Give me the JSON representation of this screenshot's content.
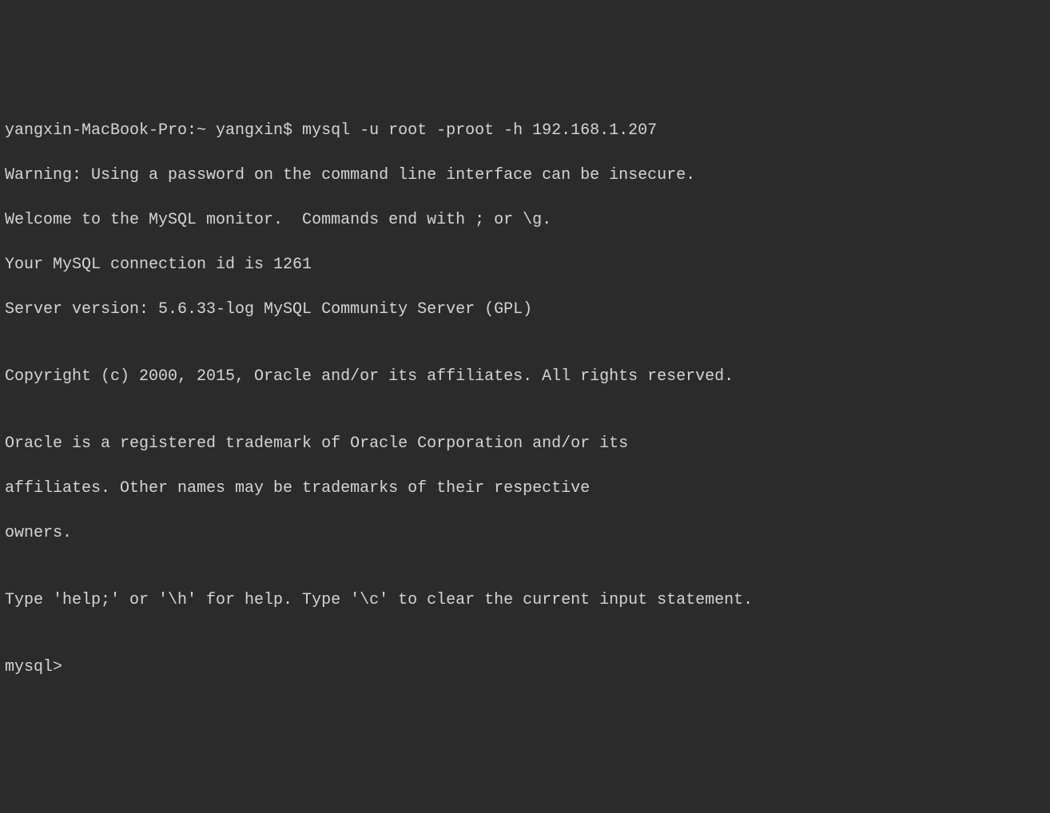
{
  "terminal": {
    "prompt_line": "yangxin-MacBook-Pro:~ yangxin$ mysql -u root -proot -h 192.168.1.207",
    "lines": [
      "Warning: Using a password on the command line interface can be insecure.",
      "Welcome to the MySQL monitor.  Commands end with ; or \\g.",
      "Your MySQL connection id is 1261",
      "Server version: 5.6.33-log MySQL Community Server (GPL)",
      "",
      "Copyright (c) 2000, 2015, Oracle and/or its affiliates. All rights reserved.",
      "",
      "Oracle is a registered trademark of Oracle Corporation and/or its",
      "affiliates. Other names may be trademarks of their respective",
      "owners.",
      "",
      "Type 'help;' or '\\h' for help. Type '\\c' to clear the current input statement.",
      "",
      "mysql> "
    ]
  }
}
